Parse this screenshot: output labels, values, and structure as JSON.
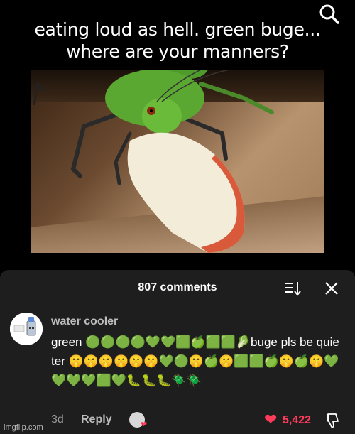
{
  "caption": "eating loud as hell. green buge... where are your manners?",
  "icons": {
    "search": "search-icon",
    "sort": "sort-icon",
    "close": "close-icon",
    "like": "heart-icon",
    "dislike": "thumbs-down-icon"
  },
  "comments_panel": {
    "title": "807 comments"
  },
  "comment": {
    "username": "water cooler",
    "text": "green 🟢🟢🟢🟢💚💚🟩🍏🟩🟩🥬buge pls be quieter 🤫🤫🤫🤫🤫🤫💚🟢🤫🍏🤫🟩🟩🍏🤫🍏🤫💚💚💚💚🟩💚🐛🐛🐛🪲🪲",
    "age": "3d",
    "reply_label": "Reply",
    "likes": "5,422"
  },
  "colors": {
    "sheet_bg": "#1e1e1e",
    "accent_like": "#ff3b5c"
  },
  "watermark": "imgflip.com"
}
